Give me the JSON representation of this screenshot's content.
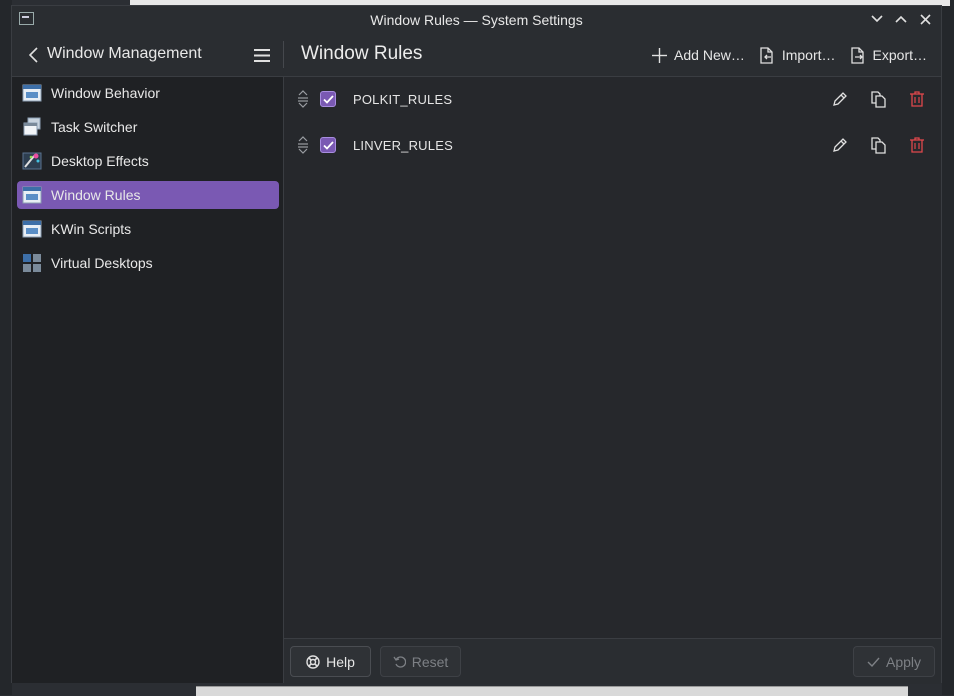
{
  "window": {
    "title": "Window Rules — System Settings"
  },
  "header": {
    "nav_title": "Window Management",
    "page_title": "Window Rules",
    "actions": [
      {
        "label": "Add New…",
        "icon": "plus-icon"
      },
      {
        "label": "Import…",
        "icon": "import-icon"
      },
      {
        "label": "Export…",
        "icon": "export-icon"
      }
    ]
  },
  "sidebar": {
    "items": [
      {
        "label": "Window Behavior",
        "icon": "window-behavior-icon",
        "active": false
      },
      {
        "label": "Task Switcher",
        "icon": "task-switcher-icon",
        "active": false
      },
      {
        "label": "Desktop Effects",
        "icon": "desktop-effects-icon",
        "active": false
      },
      {
        "label": "Window Rules",
        "icon": "window-rules-icon",
        "active": true
      },
      {
        "label": "KWin Scripts",
        "icon": "kwin-scripts-icon",
        "active": false
      },
      {
        "label": "Virtual Desktops",
        "icon": "virtual-desktops-icon",
        "active": false
      }
    ]
  },
  "rules": [
    {
      "name": "POLKIT_RULES",
      "enabled": true
    },
    {
      "name": "LINVER_RULES",
      "enabled": true
    }
  ],
  "footer": {
    "help_label": "Help",
    "reset_label": "Reset",
    "apply_label": "Apply"
  },
  "colors": {
    "accent": "#7a59b3",
    "delete": "#e0474c",
    "background": "#1f2124"
  }
}
